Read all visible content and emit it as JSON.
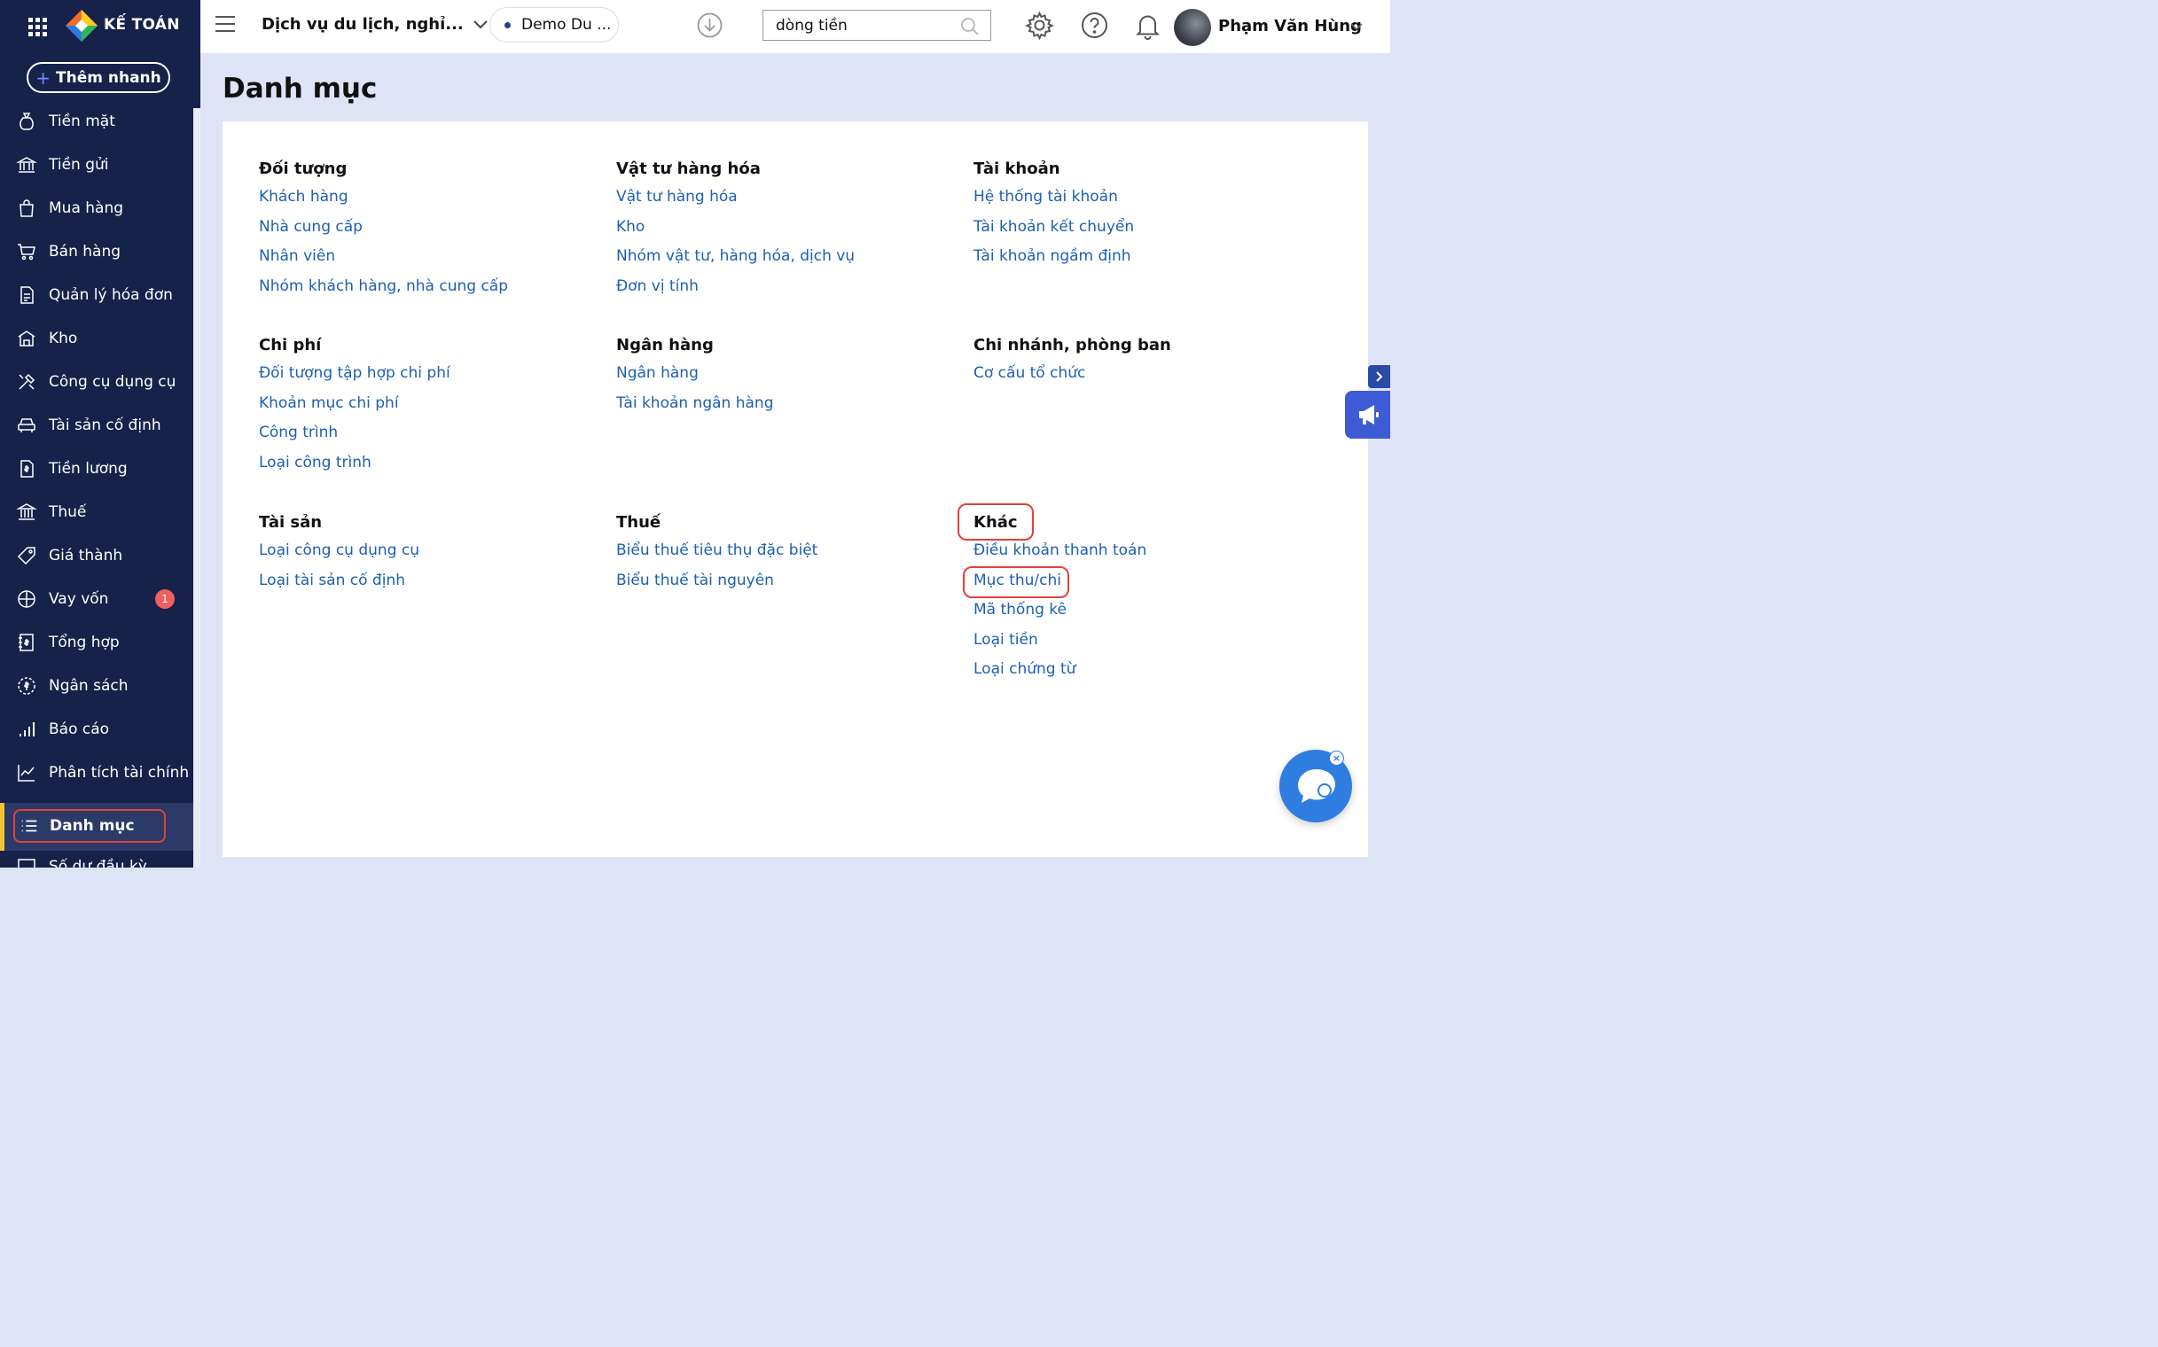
{
  "app": {
    "logo_text": "KẾ TOÁN"
  },
  "sidebar": {
    "quick_add_label": "Thêm nhanh",
    "items": [
      {
        "label": "Tiền mặt",
        "icon": "cash-bag-icon"
      },
      {
        "label": "Tiền gửi",
        "icon": "bank-icon"
      },
      {
        "label": "Mua hàng",
        "icon": "shopping-bag-icon"
      },
      {
        "label": "Bán hàng",
        "icon": "cart-icon"
      },
      {
        "label": "Quản lý hóa đơn",
        "icon": "invoice-icon"
      },
      {
        "label": "Kho",
        "icon": "warehouse-icon"
      },
      {
        "label": "Công cụ dụng cụ",
        "icon": "tools-icon"
      },
      {
        "label": "Tài sản cố định",
        "icon": "asset-icon"
      },
      {
        "label": "Tiền lương",
        "icon": "salary-icon"
      },
      {
        "label": "Thuế",
        "icon": "tax-icon"
      },
      {
        "label": "Giá thành",
        "icon": "price-tag-icon"
      },
      {
        "label": "Vay vốn",
        "icon": "loan-icon",
        "badge": "1"
      },
      {
        "label": "Tổng hợp",
        "icon": "ledger-icon"
      },
      {
        "label": "Ngân sách",
        "icon": "budget-icon"
      },
      {
        "label": "Báo cáo",
        "icon": "report-chart-icon"
      },
      {
        "label": "Phân tích tài chính",
        "icon": "analysis-icon"
      }
    ],
    "active_label": "Danh mục",
    "next_label_cut": "Số dư đầu kỳ"
  },
  "header": {
    "company": "Dịch vụ du lịch, nghỉ...",
    "database": "Demo Du ...",
    "search_value": "dòng tiền",
    "user_name": "Phạm Văn Hùng"
  },
  "page": {
    "title": "Danh mục"
  },
  "groups": [
    {
      "title": "Đối tượng",
      "links": [
        "Khách hàng",
        "Nhà cung cấp",
        "Nhân viên",
        "Nhóm khách hàng, nhà cung cấp"
      ]
    },
    {
      "title": "Vật tư hàng hóa",
      "links": [
        "Vật tư hàng hóa",
        "Kho",
        "Nhóm vật tư, hàng hóa, dịch vụ",
        "Đơn vị tính"
      ]
    },
    {
      "title": "Tài khoản",
      "links": [
        "Hệ thống tài khoản",
        "Tài khoản kết chuyển",
        "Tài khoản ngầm định"
      ]
    },
    {
      "title": "Chi phí",
      "links": [
        "Đối tượng tập hợp chi phí",
        "Khoản mục chi phí",
        "Công trình",
        "Loại công trình"
      ]
    },
    {
      "title": "Ngân hàng",
      "links": [
        "Ngân hàng",
        "Tài khoản ngân hàng"
      ]
    },
    {
      "title": "Chi nhánh, phòng ban",
      "links": [
        "Cơ cấu tổ chức"
      ]
    },
    {
      "title": "Tài sản",
      "links": [
        "Loại công cụ dụng cụ",
        "Loại tài sản cố định"
      ]
    },
    {
      "title": "Thuế",
      "links": [
        "Biểu thuế tiêu thụ đặc biệt",
        "Biểu thuế tài nguyên"
      ]
    },
    {
      "title": "Khác",
      "links": [
        "Điều khoản thanh toán",
        "Mục thu/chi",
        "Mã thống kê",
        "Loại tiền",
        "Loại chứng từ"
      ]
    }
  ],
  "colors": {
    "sidebar_bg": "#16224a",
    "link": "#1d5fb4",
    "highlight": "#e5403a",
    "badge": "#f0605d"
  }
}
